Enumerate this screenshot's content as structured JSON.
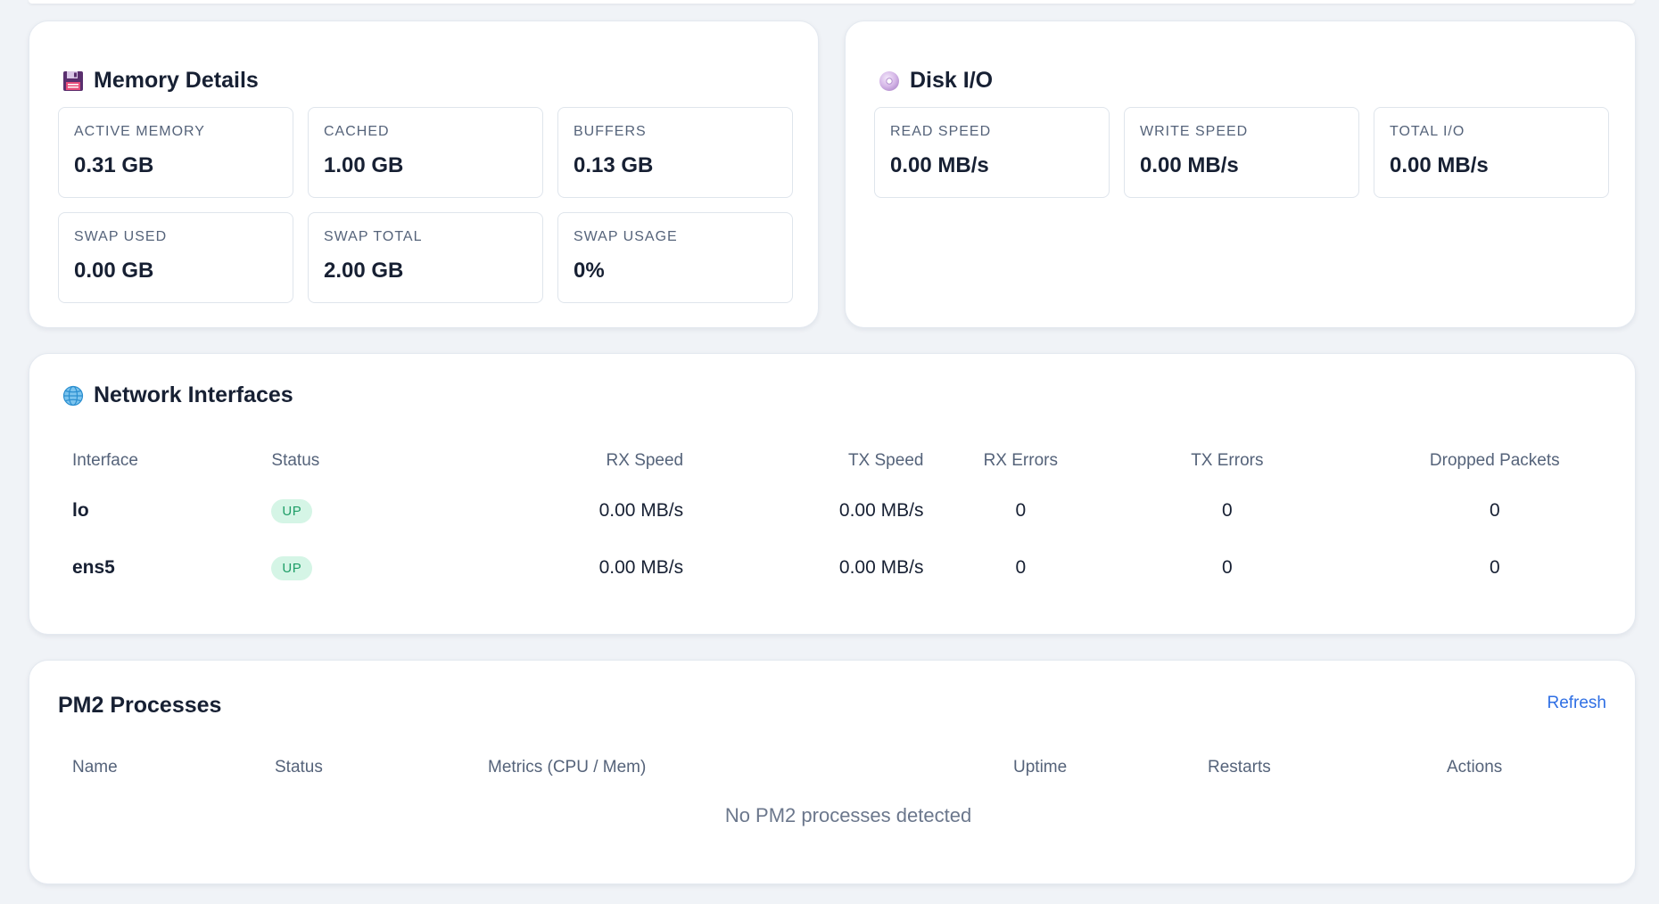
{
  "memory": {
    "title": "Memory Details",
    "icon": "floppy-disk-icon",
    "stats": [
      {
        "label": "ACTIVE MEMORY",
        "value": "0.31 GB"
      },
      {
        "label": "CACHED",
        "value": "1.00 GB"
      },
      {
        "label": "BUFFERS",
        "value": "0.13 GB"
      },
      {
        "label": "SWAP USED",
        "value": "0.00 GB"
      },
      {
        "label": "SWAP TOTAL",
        "value": "2.00 GB"
      },
      {
        "label": "SWAP USAGE",
        "value": "0%"
      }
    ]
  },
  "disk": {
    "title": "Disk I/O",
    "icon": "optical-disc-icon",
    "stats": [
      {
        "label": "READ SPEED",
        "value": "0.00 MB/s"
      },
      {
        "label": "WRITE SPEED",
        "value": "0.00 MB/s"
      },
      {
        "label": "TOTAL I/O",
        "value": "0.00 MB/s"
      }
    ]
  },
  "network": {
    "title": "Network Interfaces",
    "icon": "globe-icon",
    "columns": [
      "Interface",
      "Status",
      "RX Speed",
      "TX Speed",
      "RX Errors",
      "TX Errors",
      "Dropped Packets"
    ],
    "rows": [
      {
        "interface": "lo",
        "status": "UP",
        "rx_speed": "0.00 MB/s",
        "tx_speed": "0.00 MB/s",
        "rx_errors": "0",
        "tx_errors": "0",
        "dropped": "0"
      },
      {
        "interface": "ens5",
        "status": "UP",
        "rx_speed": "0.00 MB/s",
        "tx_speed": "0.00 MB/s",
        "rx_errors": "0",
        "tx_errors": "0",
        "dropped": "0"
      }
    ]
  },
  "pm2": {
    "title": "PM2 Processes",
    "refresh_label": "Refresh",
    "columns": [
      "Name",
      "Status",
      "Metrics (CPU / Mem)",
      "Uptime",
      "Restarts",
      "Actions"
    ],
    "empty_message": "No PM2 processes detected"
  },
  "colors": {
    "background": "#f0f3f7",
    "status_up_bg": "#d5f5e6",
    "status_up_text": "#1f9e68",
    "link": "#2f6fe4"
  }
}
